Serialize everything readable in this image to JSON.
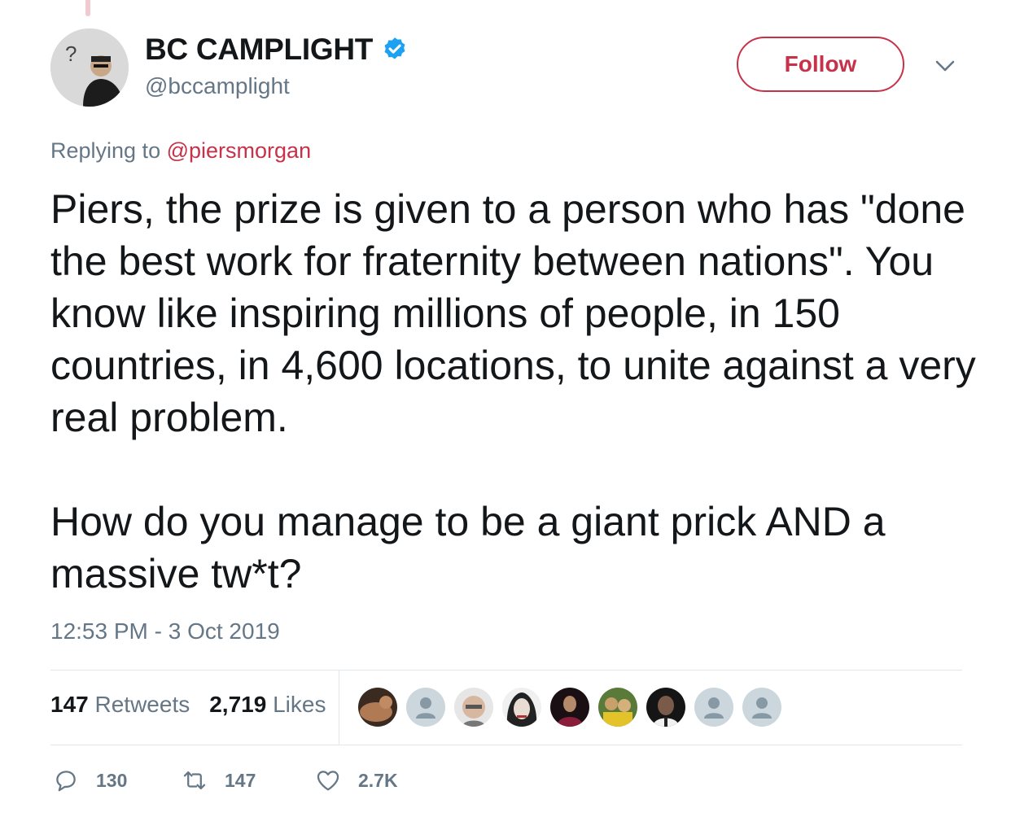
{
  "user": {
    "display_name": "BC CAMPLIGHT",
    "handle": "@bccamplight",
    "verified": true,
    "follow_label": "Follow"
  },
  "reply": {
    "prefix": "Replying to",
    "mention": "@piersmorgan"
  },
  "tweet": {
    "paragraphs": [
      "Piers, the prize is given to a person who has \"done the best work for fraternity between nations\". You know like inspiring millions of people, in 150 countries, in 4,600 locations, to unite against a very real problem.",
      "How do you manage to be a giant prick AND a massive tw*t?"
    ],
    "timestamp": "12:53 PM - 3 Oct 2019"
  },
  "stats": {
    "retweets_count": "147",
    "retweets_label": "Retweets",
    "likes_count": "2,719",
    "likes_label": "Likes"
  },
  "actions": {
    "reply_count": "130",
    "retweet_count": "147",
    "like_count": "2.7K"
  },
  "liker_avatars": [
    "photo",
    "default",
    "photo",
    "photo",
    "photo",
    "photo",
    "photo",
    "default",
    "default"
  ],
  "colors": {
    "accent": "#c7314a",
    "secondary_text": "#657786",
    "verified_blue": "#1da1f2",
    "divider": "#e1e8ed"
  }
}
